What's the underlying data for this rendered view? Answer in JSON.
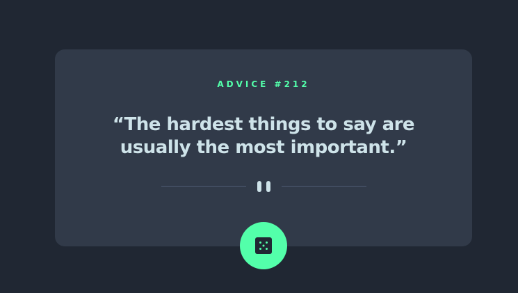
{
  "advice": {
    "label": "ADVICE #212",
    "quote": "“The hardest things to say are usually the most important.”"
  },
  "icons": {
    "divider": "pause-icon",
    "button": "dice-icon"
  },
  "colors": {
    "background": "#202733",
    "card": "#313a49",
    "accent": "#53ffaa",
    "text": "#cee3e9",
    "divider": "#4f5d74"
  }
}
